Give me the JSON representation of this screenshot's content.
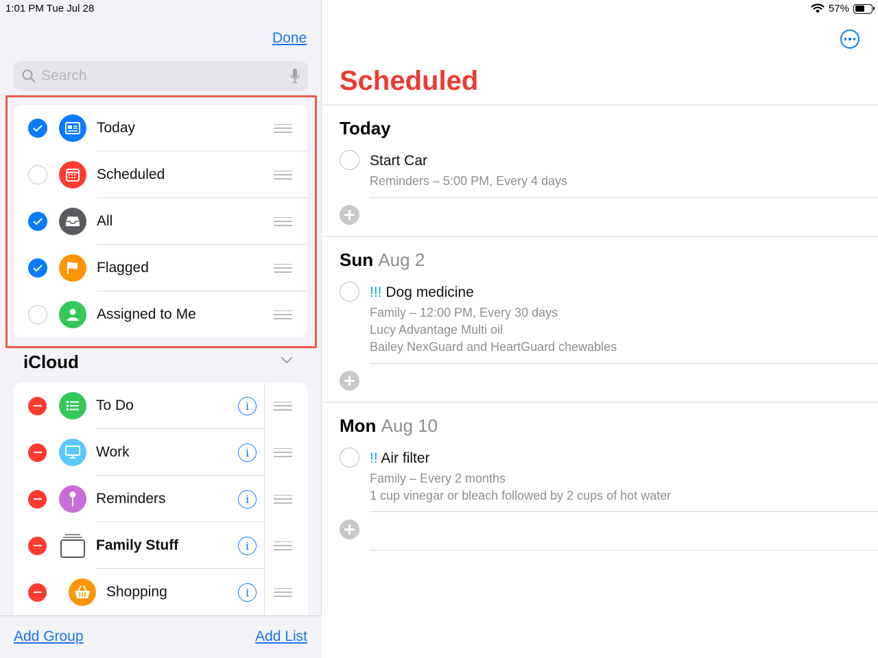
{
  "status": {
    "time": "1:01 PM   Tue Jul 28",
    "battery": "57%"
  },
  "sidebar": {
    "done_label": "Done",
    "search_placeholder": "Search",
    "smart_lists": [
      {
        "label": "Today",
        "checked": true,
        "color": "#0a7aff",
        "icon": "calendar-today-icon"
      },
      {
        "label": "Scheduled",
        "checked": false,
        "color": "#ff3b30",
        "icon": "calendar-icon"
      },
      {
        "label": "All",
        "checked": true,
        "color": "#5a5a5f",
        "icon": "tray-icon"
      },
      {
        "label": "Flagged",
        "checked": true,
        "color": "#ff9500",
        "icon": "flag-icon"
      },
      {
        "label": "Assigned to Me",
        "checked": false,
        "color": "#34c759",
        "icon": "person-icon"
      }
    ],
    "icloud_title": "iCloud",
    "lists": [
      {
        "label": "To Do",
        "color": "#34c759",
        "icon": "list-icon"
      },
      {
        "label": "Work",
        "color": "#5ac8fa",
        "icon": "monitor-icon"
      },
      {
        "label": "Reminders",
        "color": "#c86dd7",
        "icon": "pin-icon"
      },
      {
        "label": "Family Stuff",
        "color": "#ffffff",
        "icon": "stack-icon",
        "bold": true
      },
      {
        "label": "Shopping",
        "color": "#ff9500",
        "icon": "basket-icon"
      }
    ],
    "add_group": "Add Group",
    "add_list": "Add List"
  },
  "main": {
    "title": "Scheduled",
    "sections": [
      {
        "day": "Today",
        "date": ""
      },
      {
        "day": "Sun",
        "date": "Aug 2"
      },
      {
        "day": "Mon",
        "date": "Aug 10"
      }
    ],
    "reminders": {
      "start_car": {
        "title": "Start Car",
        "sub1": "Reminders – 5:00 PM, Every 4 days"
      },
      "dog_medicine": {
        "priority": "!!!",
        "title": "Dog medicine",
        "sub1": "Family – 12:00 PM, Every 30 days",
        "sub2": "Lucy Advantage Multi oil",
        "sub3": "Bailey NexGuard and HeartGuard chewables"
      },
      "air_filter": {
        "priority": "!!",
        "title": "Air filter",
        "sub1": "Family – Every 2 months",
        "sub2": "1 cup vinegar or bleach followed by 2 cups of hot water"
      }
    }
  }
}
